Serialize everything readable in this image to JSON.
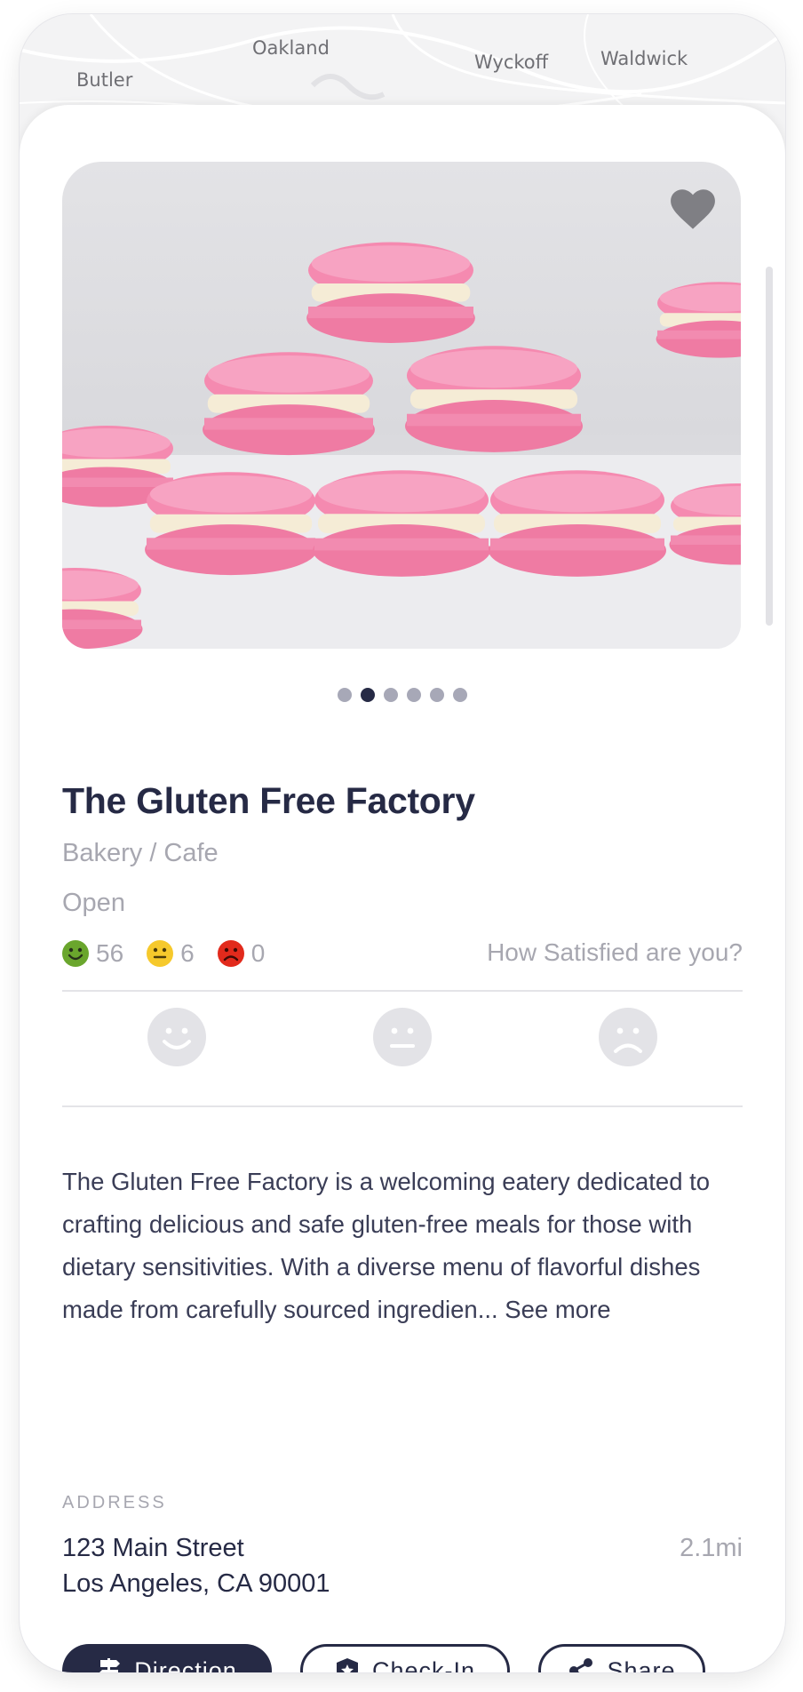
{
  "map": {
    "labels": [
      "Oakland",
      "Butler",
      "Wyckoff",
      "Waldwick"
    ]
  },
  "gallery": {
    "image_alt": "pink macarons",
    "image_count": 6,
    "active_index": 1,
    "favorite_icon": "heart-icon"
  },
  "place": {
    "name": "The Gluten Free Factory",
    "category": "Bakery / Cafe",
    "status": "Open"
  },
  "ratings": {
    "happy": "56",
    "neutral": "6",
    "sad": "0",
    "prompt": "How Satisfied are you?"
  },
  "description": {
    "text": "The Gluten Free Factory is a welcoming eatery dedicated to crafting delicious and safe gluten-free meals for those with dietary sensitivities. With a diverse menu of flavorful dishes made from carefully sourced ingredien...",
    "see_more": "See more"
  },
  "address": {
    "label": "ADDRESS",
    "line1": "123 Main Street",
    "line2": "Los Angeles, CA 90001",
    "distance": "2.1mi"
  },
  "actions": {
    "direction": "Direction",
    "checkin": "Check-In",
    "share": "Share"
  },
  "colors": {
    "primary": "#262a45",
    "muted": "#a7a7b0",
    "happy": "#6aa62d",
    "neutral": "#f6c92c",
    "sad": "#e22a1c",
    "macaron": "#f08aa6"
  }
}
